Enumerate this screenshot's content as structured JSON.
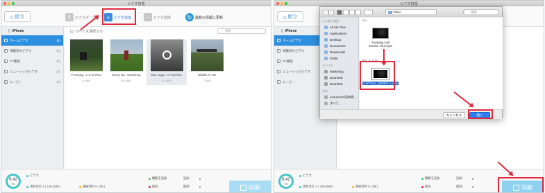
{
  "window_title": "ビデオ管理",
  "left": {
    "toolbar": {
      "back_label": "戻り",
      "export_label": "エクスポート",
      "add_label": "ビデオ追加",
      "delete_label": "ビデオ削除",
      "refresh_label": "最新の情報に更新"
    },
    "sidebar": {
      "device": "iPhone",
      "items": [
        {
          "label": "ホームビデオ",
          "count": "(4)"
        },
        {
          "label": "視聴済みビデオ",
          "count": "(0)"
        },
        {
          "label": "TV番組",
          "count": "(0)"
        },
        {
          "label": "ミュージックビデオ",
          "count": "(0)"
        },
        {
          "label": "ムービー",
          "count": "(0)"
        }
      ]
    },
    "content": {
      "select_all": "すべてを選択する",
      "search_placeholder": "検索",
      "videos": [
        {
          "name": "TruSwing...e & 6s Plus",
          "size": "5.2MB"
        },
        {
          "name": "Demo Da...Workshop",
          "size": "88.4MB"
        },
        {
          "name": "Bon Hoge...n/ YouTube",
          "size": "28.3MB"
        },
        {
          "name": "Wildlife in HD",
          "size": "7.0MB"
        }
      ]
    },
    "footer": {
      "storage_value": "6.42",
      "storage_unit": "GB",
      "category": "ビデオ",
      "total": "項目合計 4 ( 129.3MB )",
      "selected": "選択項目 0 ( 0B )",
      "add_legend": "機能を追加",
      "delete_legend": "削除",
      "add_value": "追加：",
      "add_count": "0",
      "delete_value": "削除：",
      "delete_count": "0",
      "sync_label": "同期"
    }
  },
  "right": {
    "dialog": {
      "folder": "Video",
      "search_placeholder": "検索",
      "favorites_head": "よく使う項目",
      "favorites": [
        "All My Files",
        "Applications",
        "Desktop",
        "Documents",
        "Downloads",
        "Public"
      ],
      "devices_head": "デバイス",
      "devices": [
        "Marketing",
        "DearMob",
        "DearMob"
      ],
      "shared_head": "共有",
      "shared": [
        "acmacmini的共有...",
        "すべて..."
      ],
      "earlier_head": "今日",
      "earlier_file": "TruSwing Golf Sensor...Plus.mp4",
      "recent_head": "過去 30 日間",
      "selected_file": "CAPTAIN_AMERIC A.mp4",
      "cancel_label": "キャンセル",
      "open_label": "開く"
    },
    "toolbar": {
      "back_label": "戻り"
    },
    "sidebar": {
      "device": "iPhone",
      "items": [
        {
          "label": "ホームビデオ",
          "count": "(4)"
        },
        {
          "label": "視聴済みビデオ",
          "count": "(0)"
        },
        {
          "label": "TV番組",
          "count": "(0)"
        },
        {
          "label": "ミュージックビデオ",
          "count": "(0)"
        },
        {
          "label": "ムービー",
          "count": "(0)"
        }
      ]
    },
    "footer": {
      "storage_value": "6.42",
      "storage_unit": "GB",
      "category": "ビデオ",
      "total": "項目合計 4 ( 129.3MB )",
      "selected": "選択項目 0 ( 0B )",
      "add_legend": "機能を追加",
      "delete_legend": "削除",
      "add_value": "追加：",
      "add_count": "0",
      "delete_value": "削除：",
      "delete_count": "0",
      "sync_label": "同期"
    }
  },
  "colors": {
    "accent": "#2d8fe0",
    "highlight": "#e0293d",
    "sync": "#a8ddf3",
    "storage_ring": "#45c5c8"
  }
}
